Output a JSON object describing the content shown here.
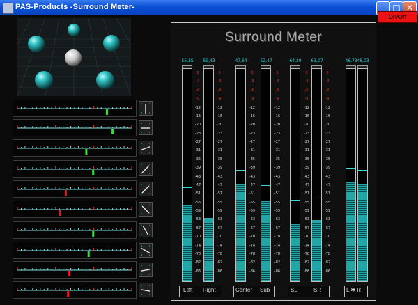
{
  "window": {
    "title": "PAS-Products  -Surround Meter-",
    "min_icon": "minimize-icon",
    "max_icon": "maximize-icon",
    "close_icon": "close-icon",
    "onoff_label": "On/Off"
  },
  "panel": {
    "title": "Surround Meter"
  },
  "fader_count": 10,
  "meters": {
    "scale": [
      "0",
      "-3",
      "-6",
      "-9",
      "-12",
      "-16",
      "-20",
      "-23",
      "-27",
      "-31",
      "-35",
      "-39",
      "-43",
      "-47",
      "-51",
      "-55",
      "-59",
      "-63",
      "-67",
      "-70",
      "-74",
      "-78",
      "-82",
      "-86"
    ],
    "red_marks": [
      "0",
      "-3",
      "-6",
      "-9"
    ],
    "channels": [
      {
        "name": "Left",
        "peak": "-55,35",
        "level": 0.36,
        "hold": 0.44
      },
      {
        "name": "Right",
        "peak": "-59,43",
        "level": 0.3,
        "hold": 0.4
      },
      {
        "name": "Center",
        "peak": "-47,64",
        "level": 0.46,
        "hold": 0.52
      },
      {
        "name": "Sub",
        "peak": "-52,47",
        "level": 0.38,
        "hold": 0.45
      },
      {
        "name": "SL",
        "peak": "-64,29",
        "level": 0.27,
        "hold": 0.38
      },
      {
        "name": "SR",
        "peak": "-63,07",
        "level": 0.29,
        "hold": 0.39
      },
      {
        "name": "L",
        "peak": "-46,73",
        "level": 0.47,
        "hold": 0.53
      },
      {
        "name": "R",
        "peak": "-48,03",
        "level": 0.46,
        "hold": 0.52
      }
    ],
    "labels": {
      "left": "Left",
      "right": "Right",
      "center": "Center",
      "sub": "Sub",
      "sl": "SL",
      "sr": "SR",
      "lr": "L ✱ R"
    }
  }
}
